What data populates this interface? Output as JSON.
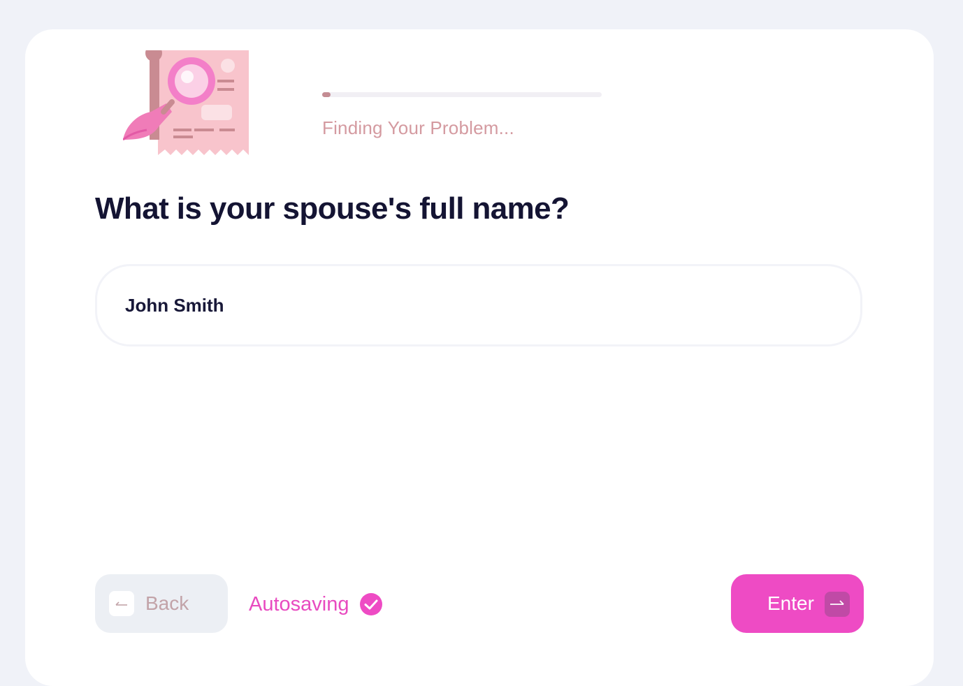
{
  "progress": {
    "label": "Finding Your Problem...",
    "fraction": 0.03
  },
  "question": {
    "title": "What is your spouse's full name?"
  },
  "name_field": {
    "value": "John Smith"
  },
  "footer": {
    "back_label": "Back",
    "autosave_label": "Autosaving",
    "enter_label": "Enter"
  },
  "icons": {
    "illustration": "document-magnifier-illustration",
    "back": "arrow-left-icon",
    "autosave": "check-circle-icon",
    "enter": "arrow-right-icon"
  },
  "colors": {
    "accent": "#ee4bc4",
    "progress_fill": "#c48c93",
    "heading": "#141433"
  }
}
